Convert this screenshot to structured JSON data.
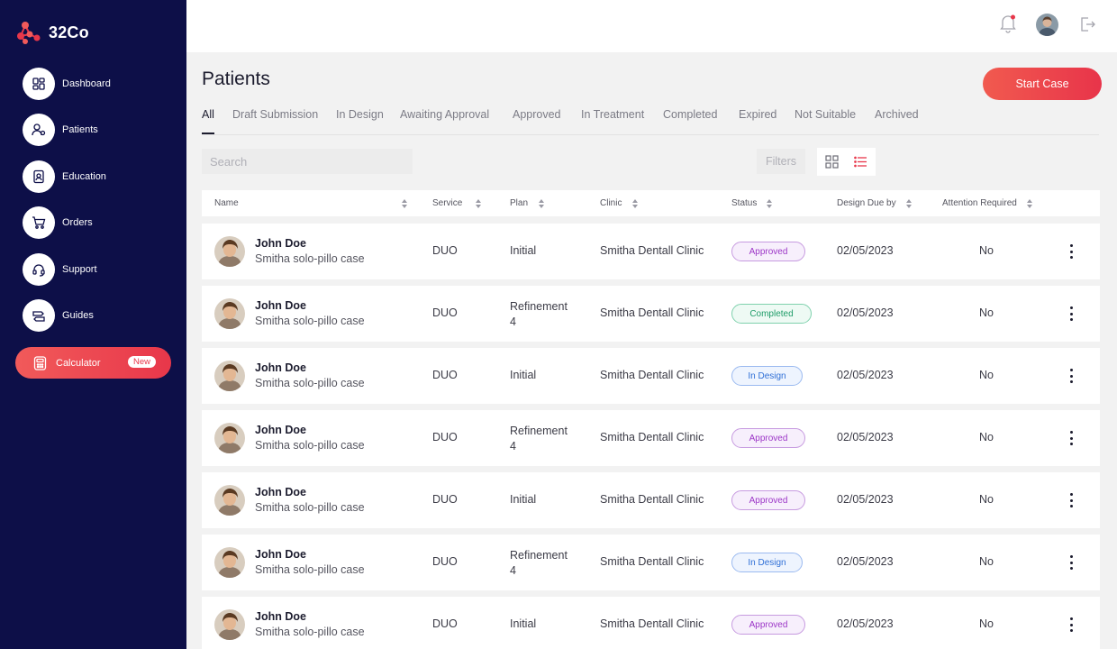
{
  "app": {
    "name": "32Co"
  },
  "colors": {
    "sidebar": "#0d0f48",
    "accent": "#e8374a",
    "approved": "#9c36c7",
    "completed": "#1f9c68",
    "in_design": "#2f6fd6"
  },
  "sidebar": {
    "items": [
      {
        "label": "Dashboard",
        "icon": "dashboard-icon"
      },
      {
        "label": "Patients",
        "icon": "patients-icon"
      },
      {
        "label": "Education",
        "icon": "education-icon"
      },
      {
        "label": "Orders",
        "icon": "cart-icon"
      },
      {
        "label": "Support",
        "icon": "headset-icon"
      },
      {
        "label": "Guides",
        "icon": "guides-icon"
      }
    ],
    "calculator": {
      "label": "Calculator",
      "badge": "New",
      "icon": "calculator-icon"
    }
  },
  "header": {
    "icons": [
      "bell-icon",
      "avatar",
      "logout-icon"
    ]
  },
  "main": {
    "title": "Patients",
    "start_case_label": "Start Case",
    "tabs": [
      {
        "label": "All",
        "active": true
      },
      {
        "label": "Draft Submission"
      },
      {
        "label": "In Design"
      },
      {
        "label": "Awaiting Approval"
      },
      {
        "label": "Approved"
      },
      {
        "label": "In Treatment"
      },
      {
        "label": "Completed"
      },
      {
        "label": "Expired"
      },
      {
        "label": "Not Suitable"
      },
      {
        "label": "Archived"
      }
    ],
    "search": {
      "placeholder": "Search"
    },
    "filters_label": "Filters",
    "view_mode": "list"
  },
  "table": {
    "columns": [
      "Name",
      "Service",
      "Plan",
      "Clinic",
      "Status",
      "Design Due by",
      "Attention Required"
    ],
    "rows": [
      {
        "name": "John Doe",
        "case": "Smitha solo-pillo case",
        "service": "DUO",
        "plan": "Initial",
        "clinic": "Smitha Dentall Clinic",
        "status": "Approved",
        "due": "02/05/2023",
        "attention": "No"
      },
      {
        "name": "John Doe",
        "case": "Smitha solo-pillo case",
        "service": "DUO",
        "plan": "Refinement 4",
        "clinic": "Smitha Dentall Clinic",
        "status": "Completed",
        "due": "02/05/2023",
        "attention": "No"
      },
      {
        "name": "John Doe",
        "case": "Smitha solo-pillo case",
        "service": "DUO",
        "plan": "Initial",
        "clinic": "Smitha Dentall Clinic",
        "status": "In Design",
        "due": "02/05/2023",
        "attention": "No"
      },
      {
        "name": "John Doe",
        "case": "Smitha solo-pillo case",
        "service": "DUO",
        "plan": "Refinement 4",
        "clinic": "Smitha Dentall Clinic",
        "status": "Approved",
        "due": "02/05/2023",
        "attention": "No"
      },
      {
        "name": "John Doe",
        "case": "Smitha solo-pillo case",
        "service": "DUO",
        "plan": "Initial",
        "clinic": "Smitha Dentall Clinic",
        "status": "Approved",
        "due": "02/05/2023",
        "attention": "No"
      },
      {
        "name": "John Doe",
        "case": "Smitha solo-pillo case",
        "service": "DUO",
        "plan": "Refinement 4",
        "clinic": "Smitha Dentall Clinic",
        "status": "In Design",
        "due": "02/05/2023",
        "attention": "No"
      },
      {
        "name": "John Doe",
        "case": "Smitha solo-pillo case",
        "service": "DUO",
        "plan": "Initial",
        "clinic": "Smitha Dentall Clinic",
        "status": "Approved",
        "due": "02/05/2023",
        "attention": "No"
      }
    ]
  }
}
